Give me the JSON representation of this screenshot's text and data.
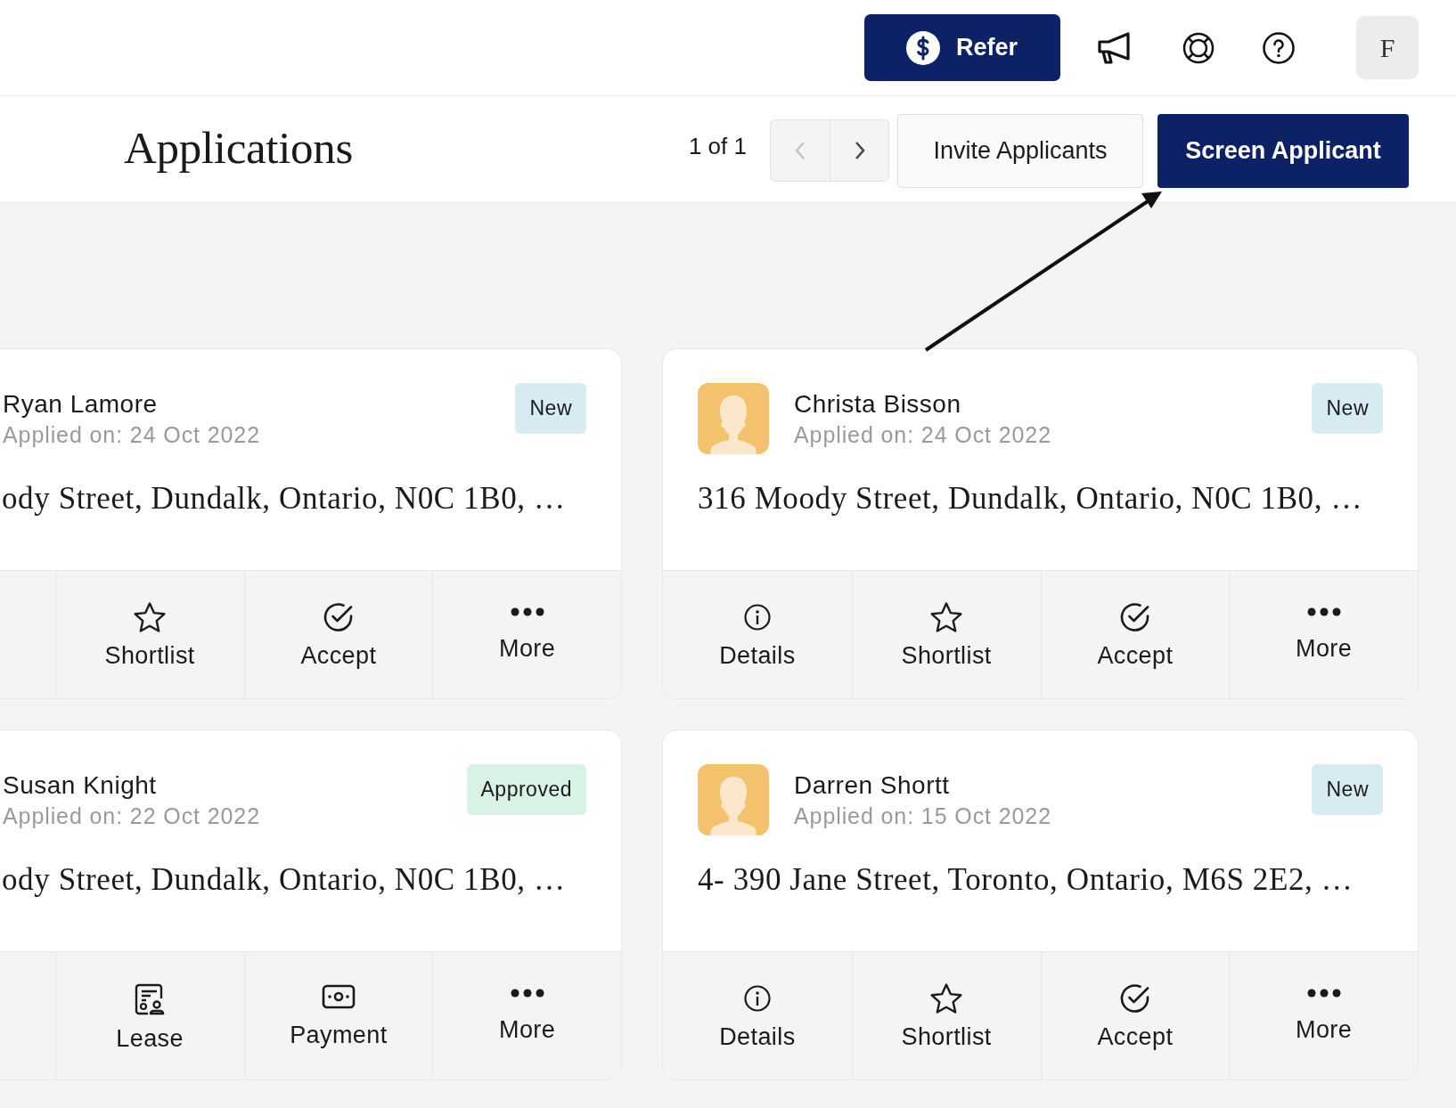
{
  "topbar": {
    "refer_button": "Refer",
    "avatar_initial": "F"
  },
  "header": {
    "title": "Applications",
    "page_count": "1 of 1",
    "pager": [
      {
        "kind": "prev",
        "disabled": true
      },
      {
        "kind": "next",
        "disabled": false
      }
    ],
    "invite_button": "Invite Applicants",
    "screen_button": "Screen Applicant"
  },
  "cards": [
    {
      "cut_off_left": true,
      "name": "Ryan Lamore",
      "applied": "Applied on: 24 Oct 2022",
      "status": {
        "label": "New",
        "kind": "new"
      },
      "address": "ody Street, Dundalk, Ontario, N0C 1B0, …",
      "actions": [
        {
          "kind": "shortlist",
          "label": "Shortlist"
        },
        {
          "kind": "accept",
          "label": "Accept"
        },
        {
          "kind": "more",
          "label": "More"
        }
      ]
    },
    {
      "cut_off_left": false,
      "name": "Christa Bisson",
      "applied": "Applied on: 24 Oct 2022",
      "status": {
        "label": "New",
        "kind": "new"
      },
      "address": "316 Moody Street, Dundalk, Ontario, N0C 1B0, …",
      "actions": [
        {
          "kind": "details",
          "label": "Details"
        },
        {
          "kind": "shortlist",
          "label": "Shortlist"
        },
        {
          "kind": "accept",
          "label": "Accept"
        },
        {
          "kind": "more",
          "label": "More"
        }
      ]
    },
    {
      "cut_off_left": true,
      "name": "Susan Knight",
      "applied": "Applied on: 22 Oct 2022",
      "status": {
        "label": "Approved",
        "kind": "approved"
      },
      "address": "ody Street, Dundalk, Ontario, N0C 1B0, …",
      "actions": [
        {
          "kind": "lease",
          "label": "Lease"
        },
        {
          "kind": "payment",
          "label": "Payment"
        },
        {
          "kind": "more",
          "label": "More"
        }
      ]
    },
    {
      "cut_off_left": false,
      "name": "Darren Shortt",
      "applied": "Applied on: 15 Oct 2022",
      "status": {
        "label": "New",
        "kind": "new"
      },
      "address": "4- 390 Jane Street, Toronto, Ontario, M6S 2E2, …",
      "actions": [
        {
          "kind": "details",
          "label": "Details"
        },
        {
          "kind": "shortlist",
          "label": "Shortlist"
        },
        {
          "kind": "accept",
          "label": "Accept"
        },
        {
          "kind": "more",
          "label": "More"
        }
      ]
    }
  ]
}
